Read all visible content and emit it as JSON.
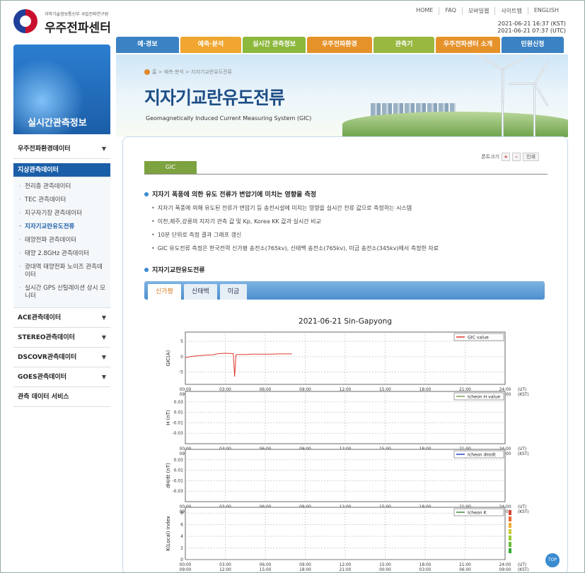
{
  "header": {
    "org_sub": "과학기술정보통신부 국립전파연구원",
    "org_name": "우주전파센터",
    "top_nav": [
      "HOME",
      "FAQ",
      "모바일웹",
      "사이트맵",
      "ENGLISH"
    ],
    "clock_kst": "2021-06-21 16:37 (KST)",
    "clock_utc": "2021-06-21 07:37 (UTC)",
    "gnb": [
      {
        "label": "예·경보",
        "color": "#3b82c4"
      },
      {
        "label": "예측·분석",
        "color": "#f0a630"
      },
      {
        "label": "실시간 관측정보",
        "color": "#8cb83c"
      },
      {
        "label": "우주전파환경",
        "color": "#e6922b"
      },
      {
        "label": "관측기",
        "color": "#98b840"
      },
      {
        "label": "우주전파센터 소개",
        "color": "#e6922b"
      },
      {
        "label": "민원신청",
        "color": "#3b82c4"
      }
    ]
  },
  "banner": {
    "breadcrumb": "홈 > 예측·분석 > 지자기교란유도전류",
    "title": "지자기교란유도전류",
    "subtitle": "Geomagnetically Induced Current Measuring System (GIC)"
  },
  "sidebar": {
    "box_label": "실시간관측정보",
    "sections": [
      {
        "label": "우주전파환경데이터",
        "arrow": "▼"
      },
      {
        "label": "지상관측데이터"
      },
      {
        "label": "ACE관측데이터",
        "arrow": "▼"
      },
      {
        "label": "STEREO관측데이터",
        "arrow": "▼"
      },
      {
        "label": "DSCOVR관측데이터",
        "arrow": "▼"
      },
      {
        "label": "GOES관측데이터",
        "arrow": "▼"
      },
      {
        "label": "관측 데이터 서비스"
      }
    ],
    "sub_items": [
      "전리층 관측데이터",
      "TEC 관측데이터",
      "지구자기장 관측데이터",
      "지자기교란유도전류",
      "태양전파 관측데이터",
      "태양 2.8GHz 관측데이터",
      "광대역 태양전파 노이즈 관측데이터",
      "실시간 GPS 신틸레이션 상시 모니터"
    ]
  },
  "content": {
    "font_size_label": "폰트크기",
    "font_plus": "+",
    "font_minus": "-",
    "print_label": "인쇄",
    "tab_label": "GIC",
    "section1_title": "지자기 폭풍에 의한 유도 전류가 변압기에 미치는 영향을 측정",
    "bullets": [
      "지자기 폭풍에 의해 유도된 전류가 변압기 등 송전시설에 미치는 영향을 실시간 전류 값으로 측정하는 시스템",
      "이천,제주,강릉의 지자기 관측 값 및 Kp, Korea KK 값과 실시간 비교",
      "10분 단위로 측정 결과 그래프 갱신",
      "GIC 유도전류 측정은 한국전력 신가평 송전소(765kv), 신태백 송전소(765kv), 미금 송전소(345kv)에서 측정한 자료"
    ],
    "section2_title": "지자기교란유도전류",
    "station_tabs": [
      "신가평",
      "신태백",
      "미금"
    ],
    "top_label": "TOP"
  },
  "chart_data": {
    "type": "line",
    "title": "2021-06-21 Sin-Gapyong",
    "x_tick_labels_ut": [
      "00:00",
      "03:00",
      "06:00",
      "09:00",
      "12:00",
      "15:00",
      "18:00",
      "21:00",
      "24:00"
    ],
    "x_tick_labels_kst": [
      "09:00",
      "12:00",
      "15:00",
      "18:00",
      "21:00",
      "00:00",
      "03:00",
      "06:00",
      "09:00"
    ],
    "x_unit_ut": "(UT)",
    "x_unit_kst": "(KST)",
    "panels": [
      {
        "ylabel": "GIC(A)",
        "legend": "GIC value",
        "color": "#e0392b",
        "ylim": [
          -9,
          8
        ],
        "y_ticks": [
          5,
          0,
          -5
        ],
        "x_hours": [
          0,
          0.5,
          1,
          1.5,
          2,
          2.5,
          3,
          3.6,
          3.7,
          3.8,
          3.9,
          4.5,
          5,
          5.5,
          6,
          6.5,
          7,
          7.5,
          8
        ],
        "values": [
          -0.3,
          0.1,
          0.3,
          0.5,
          0.6,
          1.0,
          1.1,
          1.0,
          -6.5,
          0.6,
          0.7,
          0.7,
          0.8,
          0.8,
          0.8,
          0.8,
          0.9,
          0.9,
          0.9
        ]
      },
      {
        "ylabel": "H (nT)",
        "legend": "Icheon H value",
        "color": "#7aa05a",
        "ylim": [
          -0.05,
          0.05
        ],
        "y_ticks": [
          0.03,
          0.01,
          -0.01,
          -0.03
        ]
      },
      {
        "ylabel": "dH/dt (nT)",
        "legend": "Icheon dH/dt",
        "color": "#2848c8",
        "ylim": [
          -0.05,
          0.05
        ],
        "y_ticks": [
          0.03,
          0.01,
          -0.01,
          -0.03
        ]
      },
      {
        "ylabel": "K(Local) index",
        "legend": "Icheon K",
        "color": "#3c8c3c",
        "ylim": [
          0,
          9
        ],
        "y_ticks": [
          8,
          6,
          4,
          2,
          0
        ]
      }
    ]
  }
}
